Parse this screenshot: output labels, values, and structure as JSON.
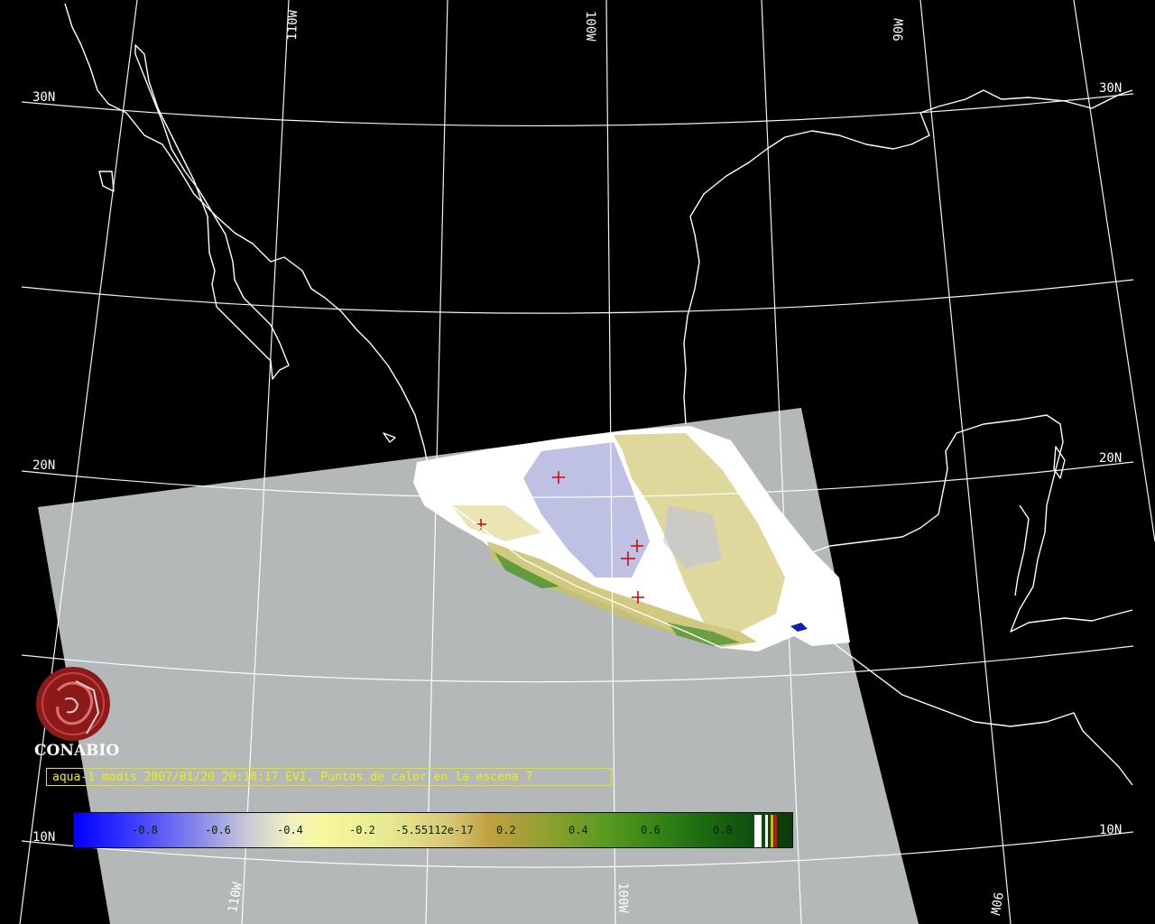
{
  "map": {
    "longitude_labels": [
      "110W",
      "100W",
      "90W"
    ],
    "latitude_labels": [
      "30N",
      "20N",
      "10N"
    ],
    "hotspot_marker": "+",
    "colors": {
      "background": "#000000",
      "grid": "#ffffff",
      "no_data": "#b4b8b8",
      "hotspot": "#cc1010",
      "caption": "#f0f000"
    }
  },
  "branding": {
    "logo_icon": "conabio-logo-icon",
    "name": "CONABIO"
  },
  "caption": "aqua-1 modis 2007/01/20 20:18:17 EVI, Puntos de calor en la escena 7",
  "legend": {
    "ticks": [
      "-0.8",
      "-0.6",
      "-0.4",
      "-0.2",
      "-5.55112e-17",
      "0.2",
      "0.4",
      "0.6",
      "0.8"
    ]
  }
}
